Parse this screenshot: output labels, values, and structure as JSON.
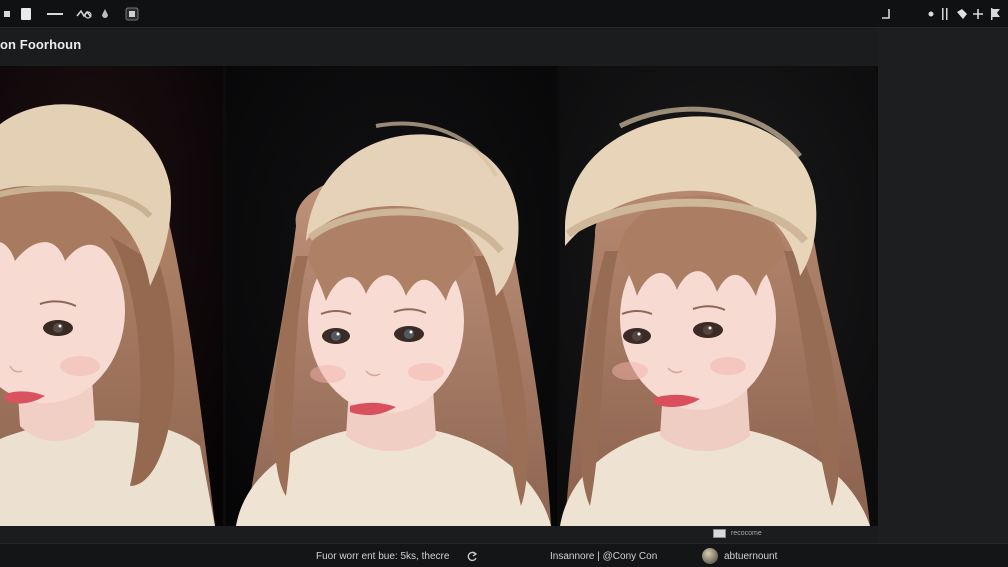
{
  "title": "on Foorhoun",
  "toolbar": {
    "left_icons": [
      "square-icon",
      "document-icon",
      "minus-icon",
      "link-icon",
      "drop-icon",
      "file-icon"
    ],
    "right_icons": [
      "corner-icon",
      "dot-icon",
      "split-icon",
      "rotate-icon",
      "cursor-icon",
      "flag-icon"
    ]
  },
  "images": [
    {
      "name": "portrait-image-1"
    },
    {
      "name": "portrait-image-2"
    },
    {
      "name": "portrait-image-3"
    }
  ],
  "caption": "recocome",
  "status": {
    "left_text": "Fuor worr ent bue: 5ks, thecre",
    "middle_text": "Insannore | @Cony Con",
    "user_name": "abtuernount"
  },
  "colors": {
    "toolbar_bg": "#101113",
    "app_bg": "#1b1c1e",
    "grid_bg": "#0c0c0d",
    "beret": "#e6d2b8",
    "hair": "#a67a5f",
    "skin": "#f6d8cf",
    "sweater": "#efe4d4"
  }
}
